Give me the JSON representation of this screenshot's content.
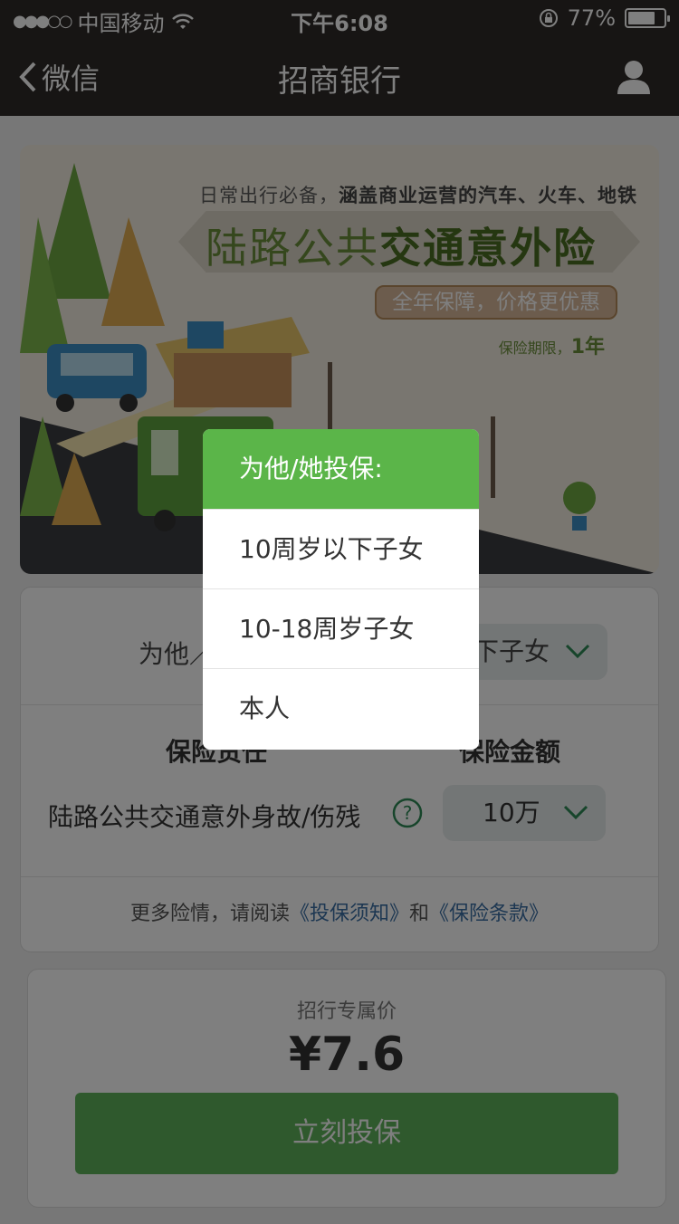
{
  "status_bar": {
    "signal": "●●●○○",
    "carrier": "中国移动",
    "time": "下午6:08",
    "battery_percent": "77%",
    "battery_level": 0.77
  },
  "nav": {
    "back_label": "微信",
    "title": "招商银行",
    "user_icon": "user-icon"
  },
  "banner": {
    "tagline_prefix": "日常出行必备，",
    "tagline_bold": "涵盖商业运营的汽车、火车、地铁",
    "title_light": "陆路公共",
    "title_bold": "交通意外险",
    "pill": "全年保障，价格更优惠",
    "period_label": "保险期限，",
    "period_value": "1年"
  },
  "form": {
    "insured_label": "为他／她投保：",
    "insured_value": "10周岁以下子女",
    "insured_value_visible": "下子女",
    "col_coverage": "保险责任",
    "col_amount": "保险金额",
    "coverage_item": "陆路公共交通意外身故/伤残",
    "amount_value": "10万",
    "terms_prefix": "更多险情，请阅读",
    "terms_link1": "《投保须知》",
    "terms_and": "和",
    "terms_link2": "《保险条款》"
  },
  "price": {
    "label": "招行专属价",
    "value": "¥7.6",
    "buy_button": "立刻投保"
  },
  "popup": {
    "header": "为他/她投保:",
    "options": [
      "10周岁以下子女",
      "10-18周岁子女",
      "本人"
    ]
  },
  "colors": {
    "nav_bg": "#2e2a28",
    "accent_green": "#5bb549",
    "link_blue": "#3a6fa5"
  }
}
